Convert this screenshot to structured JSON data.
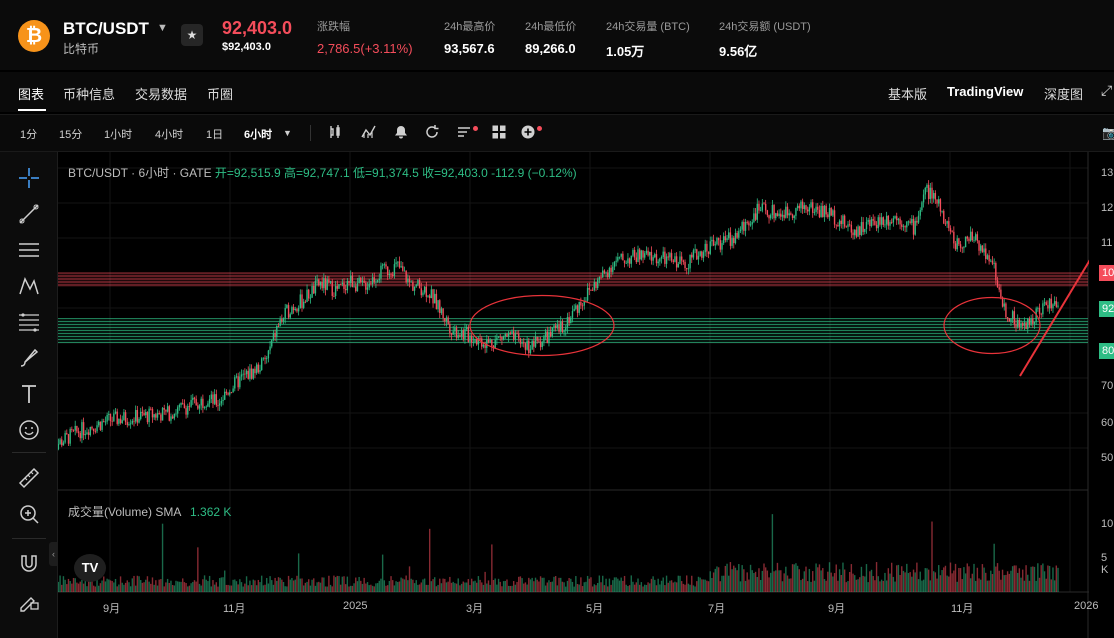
{
  "header": {
    "coin_glyph": "₿",
    "pair": "BTC/USDT",
    "coin_name": "比特币",
    "price": "92,403.0",
    "price_usd": "$92,403.0",
    "stats": [
      {
        "label": "涨跌幅",
        "value": "2,786.5(+3.11%)"
      },
      {
        "label": "24h最高价",
        "value": "93,567.6"
      },
      {
        "label": "24h最低价",
        "value": "89,266.0"
      },
      {
        "label": "24h交易量 (BTC)",
        "value": "1.05万"
      },
      {
        "label": "24h交易额 (USDT)",
        "value": "9.56亿"
      }
    ]
  },
  "tabs": {
    "left": [
      "图表",
      "币种信息",
      "交易数据",
      "币圈"
    ],
    "right": [
      "基本版",
      "TradingView",
      "深度图"
    ]
  },
  "toolbar": {
    "intervals": [
      "1分",
      "15分",
      "1小时",
      "4小时",
      "1日",
      "6小时"
    ],
    "selected_interval": "6小时",
    "icons": [
      "candle-style-icon",
      "indicators-icon",
      "alert-icon",
      "replay-icon",
      "settings-list-icon",
      "layout-grid-icon"
    ]
  },
  "sidebar": {
    "icons": [
      "crosshair-icon",
      "trendline-icon",
      "horizontal-lines-icon",
      "pattern-icon",
      "fib-icon",
      "brush-icon",
      "text-icon",
      "emoji-icon",
      "ruler-icon",
      "zoom-in-icon",
      "magnet-icon",
      "lock-draw-icon"
    ]
  },
  "chart": {
    "legend": {
      "prefix": "BTC/USDT · 6小时 · GATE",
      "values": "开=92,515.9 高=92,747.1 低=91,374.5 收=92,403.0 -112.9 (−0.12%)"
    },
    "volume_legend": {
      "label": "成交量(Volume) SMA",
      "value": "1.362 K"
    },
    "tv_logo": "TV",
    "colors": {
      "up": "#2ebd85",
      "down": "#f54d5b",
      "zone_red": "#f54d5b",
      "zone_green": "#2ebd85",
      "annotation": "#e8333a"
    }
  },
  "chart_data": {
    "type": "candlestick",
    "title": "BTC/USDT · 6小时 · GATE",
    "y_ticks": [
      "13",
      "12",
      "11",
      "10",
      "92",
      "80",
      "70",
      "60",
      "50"
    ],
    "y_badges": [
      {
        "label": "10",
        "color": "#f54d5b"
      },
      {
        "label": "92",
        "color": "#2ebd85"
      },
      {
        "label": "80",
        "color": "#2ebd85"
      }
    ],
    "volume_y_ticks": [
      "10",
      "5 K"
    ],
    "x_ticks": [
      "9月",
      "11月",
      "2025",
      "3月",
      "5月",
      "7月",
      "9月",
      "11月",
      "2026"
    ],
    "price_series_approx_k": [
      50,
      55,
      58,
      59,
      60,
      62,
      64,
      63,
      67,
      70,
      72,
      75,
      85,
      90,
      92,
      97,
      95,
      98,
      96,
      100,
      102,
      97,
      95,
      84,
      82,
      80,
      82,
      79,
      84,
      95,
      103,
      105,
      104,
      103,
      108,
      110,
      118,
      117,
      119,
      117,
      112,
      115,
      116,
      113,
      124,
      120,
      108,
      110,
      104,
      90,
      84,
      90,
      92
    ],
    "price_series_x_month": [
      8,
      8.5,
      9,
      9.5,
      10,
      10.3,
      10.6,
      10.8,
      11,
      11.2,
      11.4,
      11.6,
      11.8,
      12,
      12.2,
      12.5,
      12.8,
      13,
      13.2,
      13.5,
      13.8,
      14,
      14.3,
      14.7,
      15,
      15.3,
      15.6,
      16,
      16.5,
      17,
      17.4,
      17.8,
      18.2,
      18.6,
      19,
      19.4,
      19.8,
      20.2,
      20.6,
      21,
      21.4,
      21.8,
      22.1,
      22.4,
      22.6,
      22.8,
      23.1,
      23.4,
      23.7,
      23.9,
      24.2,
      24.5,
      24.8
    ],
    "zones": [
      {
        "label": "resistance",
        "range_k": [
          96,
          100
        ]
      },
      {
        "label": "support",
        "range_k": [
          80,
          87
        ]
      }
    ]
  }
}
